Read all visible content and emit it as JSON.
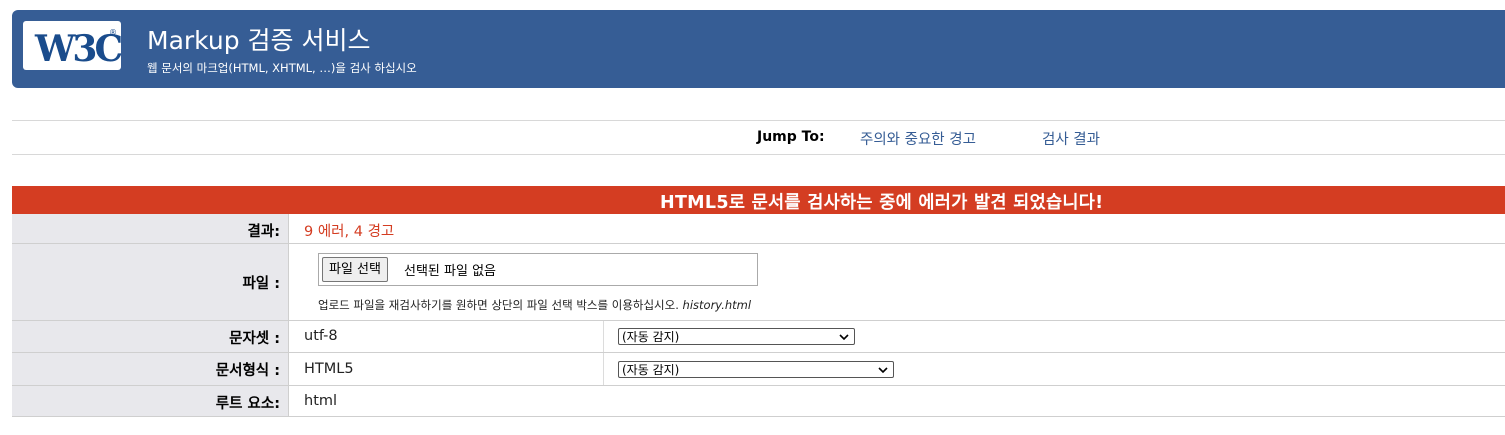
{
  "header": {
    "logo_text": "W3C",
    "title": "Markup 검증 서비스",
    "subtitle": "웹 문서의 마크업(HTML, XHTML, …)을 검사 하십시오"
  },
  "jump": {
    "label": "Jump To:",
    "links": [
      "주의와 중요한 경고",
      "검사 결과"
    ]
  },
  "error_banner": "HTML5로 문서를 검사하는 중에 에러가 발견 되었습니다!",
  "results": {
    "result": {
      "label": "결과:",
      "value": "9 에러, 4 경고"
    },
    "file": {
      "label": "파일 :",
      "button": "파일 선택",
      "no_file": "선택된 파일 없음",
      "hint": "업로드 파일을 재검사하기를 원하면 상단의 파일 선택 박스를 이용하십시오.",
      "hint_file": "history.html"
    },
    "charset": {
      "label": "문자셋 :",
      "value": "utf-8",
      "select": "(자동 감지)"
    },
    "doctype": {
      "label": "문서형식 :",
      "value": "HTML5",
      "select": "(자동 감지)"
    },
    "root": {
      "label": "루트 요소:",
      "value": "html"
    }
  },
  "colors": {
    "banner": "#365d95",
    "error": "#d43d22",
    "label_bg": "#e8e8ec"
  }
}
